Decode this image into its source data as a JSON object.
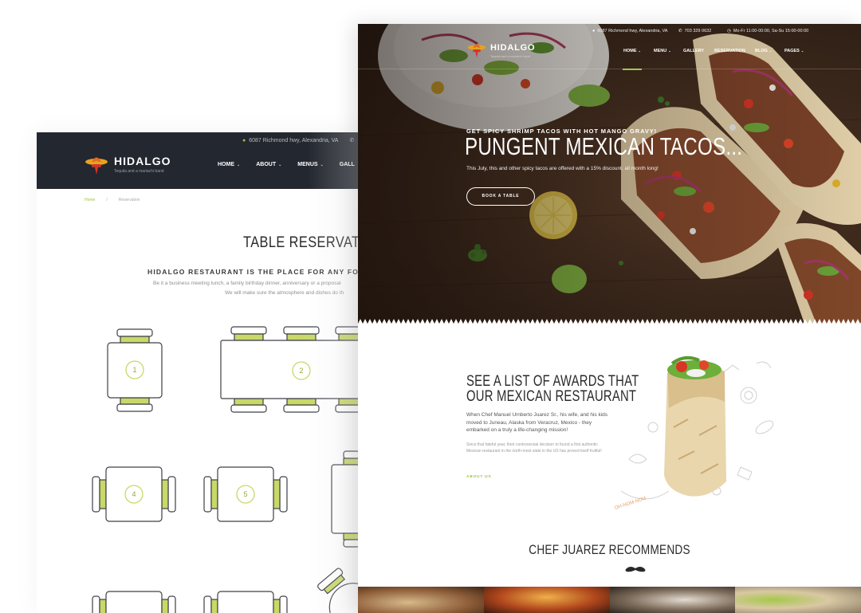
{
  "back_page": {
    "header": {
      "address": "6087 Richmond hwy, Alexandria, VA",
      "logo_name": "HIDALGO",
      "logo_tagline": "Tequila and a mariachi band",
      "nav": [
        "HOME",
        "ABOUT",
        "MENUS",
        "GALL"
      ]
    },
    "breadcrumb": {
      "home": "Home",
      "separator": "/",
      "current": "Reservation"
    },
    "title": "TABLE RESERVATION",
    "subtitle": "HIDALGO RESTAURANT IS THE PLACE FOR ANY FOOD-A",
    "desc_line1": "Be it a business meeting lunch, a family birthday dinner, anniversary or a proposal",
    "desc_line2": "We will make sure the atmosphere and dishes do th",
    "tables": [
      "1",
      "2",
      "4",
      "5"
    ]
  },
  "front_page": {
    "topbar": {
      "address": "6087 Richmond hwy, Alexandria, VA",
      "phone": "703 329 0632",
      "hours": "Mo-Fr 11:00-00:00, Sa-Su 15:00-00:00"
    },
    "logo_name": "HIDALGO",
    "logo_tagline": "Tequila and a mariachi band",
    "nav": {
      "home": "HOME",
      "menu": "MENU",
      "gallery": "GALLERY",
      "reservation": "RESERVATION",
      "blog": "BLOG",
      "pages": "PAGES"
    },
    "hero": {
      "kicker": "GET SPICY SHRIMP TACOS WITH HOT MANGO GRAVY!",
      "title": "PUNGENT MEXICAN TACOS...",
      "text": "This July, this and other spicy tacos are offered with a 15% discount, all month long!",
      "button": "BOOK A TABLE"
    },
    "about": {
      "title_line1": "SEE A LIST OF AWARDS THAT",
      "title_line2": "OUR MEXICAN RESTAURANT",
      "paragraph1": "When Chef Manuel Urnberto Juarez Sr., his wife, and his kids moved to Juneau, Alaska from Veracruz, Mexico - they embarked on a truly a life-changing mission!",
      "paragraph2": "Since that fateful year, their controversial decision to found a first authentic Mexican restaurant in the north-most state in the US has proved itself fruitful!",
      "link": "ABOUT US",
      "stamp": "OH-NOM-NOM"
    },
    "chef_title": "CHEF JUAREZ RECOMMENDS"
  },
  "colors": {
    "accent": "#9cc13b",
    "dark_header": "#23272f",
    "table_seat": "#c9d867"
  }
}
